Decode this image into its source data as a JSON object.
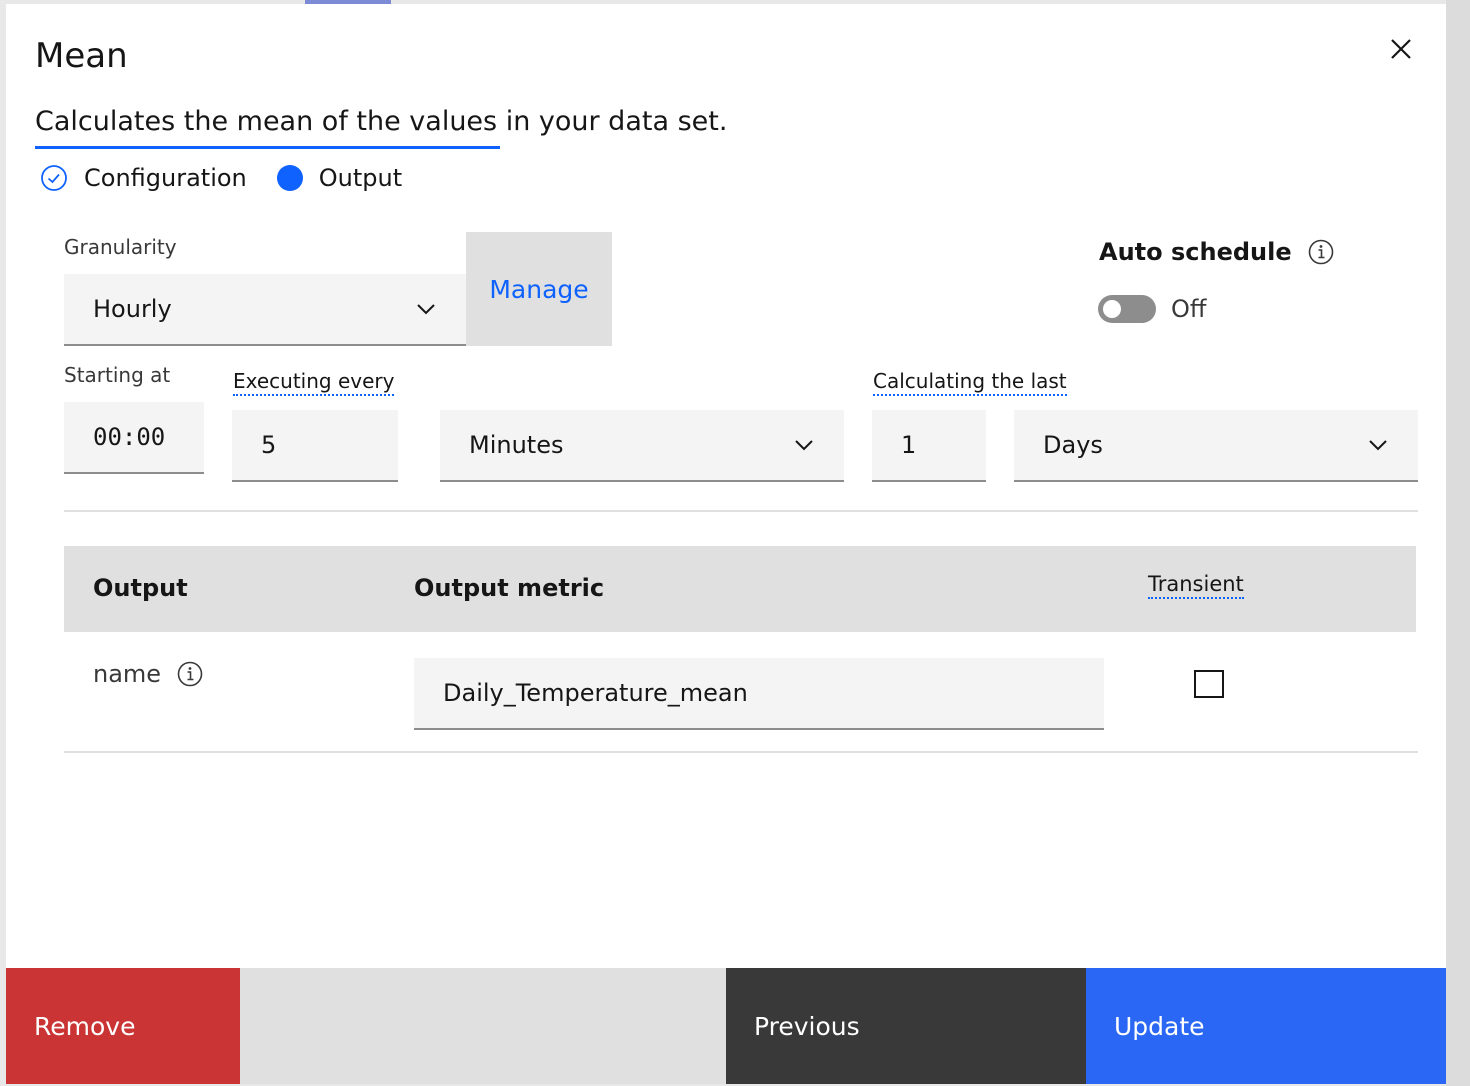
{
  "modal": {
    "title": "Mean",
    "description": "Calculates the mean of the values in your data set."
  },
  "steps": [
    {
      "label": "Configuration",
      "state": "complete"
    },
    {
      "label": "Output",
      "state": "current"
    }
  ],
  "form": {
    "granularity": {
      "label": "Granularity",
      "value": "Hourly"
    },
    "manage_label": "Manage",
    "auto_schedule": {
      "label": "Auto schedule",
      "toggle_text": "Off",
      "enabled": false
    },
    "starting_at": {
      "label": "Starting at",
      "value": "00:00"
    },
    "executing_every": {
      "label": "Executing every",
      "value": "5",
      "unit": "Minutes"
    },
    "calculating_last": {
      "label": "Calculating the last",
      "value": "1",
      "unit": "Days"
    }
  },
  "output_table": {
    "headers": {
      "output": "Output",
      "metric": "Output metric",
      "transient": "Transient"
    },
    "rows": [
      {
        "name": "name",
        "metric": "Daily_Temperature_mean",
        "transient": false
      }
    ]
  },
  "footer": {
    "remove": "Remove",
    "previous": "Previous",
    "update": "Update"
  },
  "colors": {
    "primary": "#0f62fe",
    "danger": "#cb3434",
    "dark": "#393939",
    "field_bg": "#f4f4f4"
  }
}
